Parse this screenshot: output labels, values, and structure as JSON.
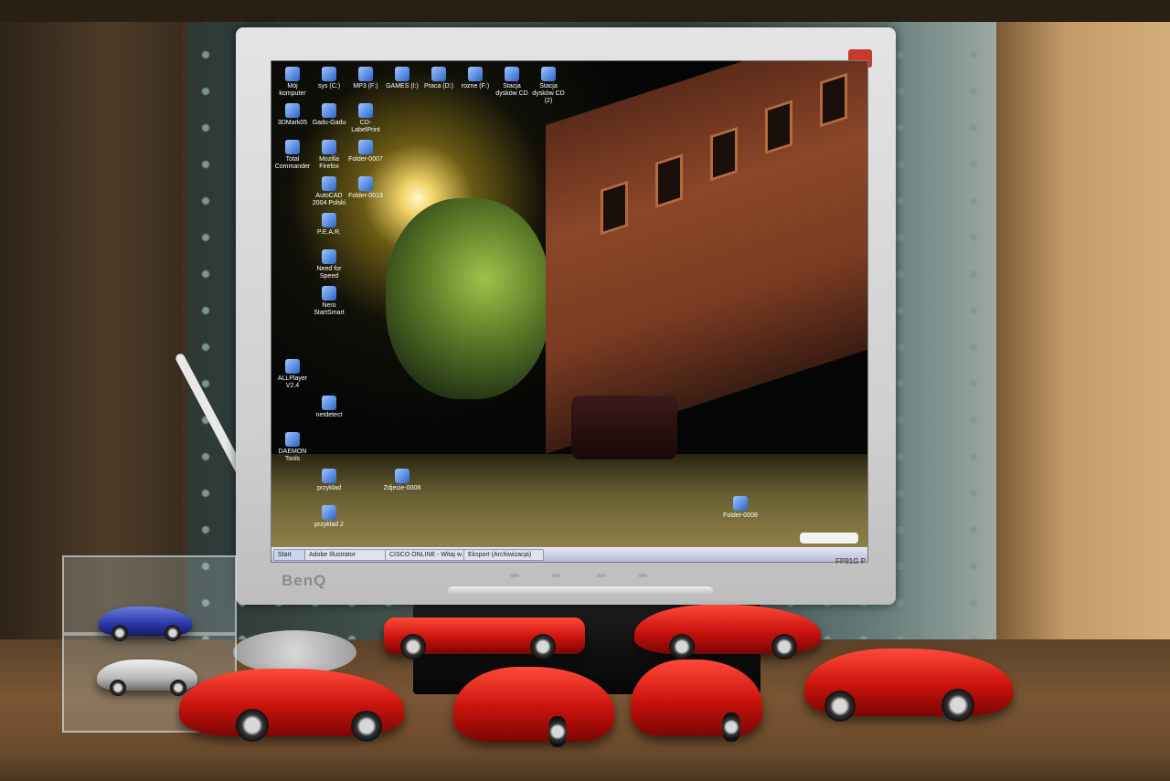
{
  "monitor": {
    "brand": "BenQ",
    "model": "FP91G P"
  },
  "desktop": {
    "icons": [
      {
        "label": "Mój komputer",
        "icon": "computer-icon"
      },
      {
        "label": "sys (C:)",
        "icon": "drive-icon"
      },
      {
        "label": "MP3 (F:)",
        "icon": "drive-icon"
      },
      {
        "label": "GAMES (I:)",
        "icon": "drive-icon"
      },
      {
        "label": "Praca (D:)",
        "icon": "drive-icon"
      },
      {
        "label": "rozne (F:)",
        "icon": "drive-icon"
      },
      {
        "label": "Stacja dysków CD",
        "icon": "cd-drive-icon"
      },
      {
        "label": "Stacja dysków CD (2)",
        "icon": "cd-drive-icon"
      },
      {
        "label": "3DMark05",
        "icon": "app-icon"
      },
      {
        "label": "Gadu-Gadu",
        "icon": "gadu-gadu-icon"
      },
      {
        "label": "CD-LabelPrint",
        "icon": "app-icon"
      },
      {
        "label": "Total Commander",
        "icon": "app-icon"
      },
      {
        "label": "Mozilla Firefox",
        "icon": "firefox-icon"
      },
      {
        "label": "Folder-0007",
        "icon": "folder-icon"
      },
      {
        "label": "AutoCAD 2004 Polski",
        "icon": "app-icon"
      },
      {
        "label": "Folder-0013",
        "icon": "folder-icon"
      },
      {
        "label": "P.E.A.R.",
        "icon": "app-icon"
      },
      {
        "label": "Need for Speed",
        "icon": "app-icon"
      },
      {
        "label": "Nero StartSmart",
        "icon": "app-icon"
      },
      {
        "label": "ALLPlayer V2.4",
        "icon": "app-icon"
      },
      {
        "label": "netdetect",
        "icon": "app-icon"
      },
      {
        "label": "DAEMON Tools",
        "icon": "app-icon"
      },
      {
        "label": "przyklad",
        "icon": "file-icon"
      },
      {
        "label": "przyklad 2",
        "icon": "file-icon"
      },
      {
        "label": "Zdjecie-0008",
        "icon": "image-icon"
      },
      {
        "label": "Folder-0008",
        "icon": "folder-icon"
      }
    ],
    "taskbar": {
      "start": "Start",
      "items": [
        "Adobe Illustrator",
        "CISCO ONLINE - Witaj w...",
        "Eksport (Archiwizacja)"
      ]
    }
  }
}
